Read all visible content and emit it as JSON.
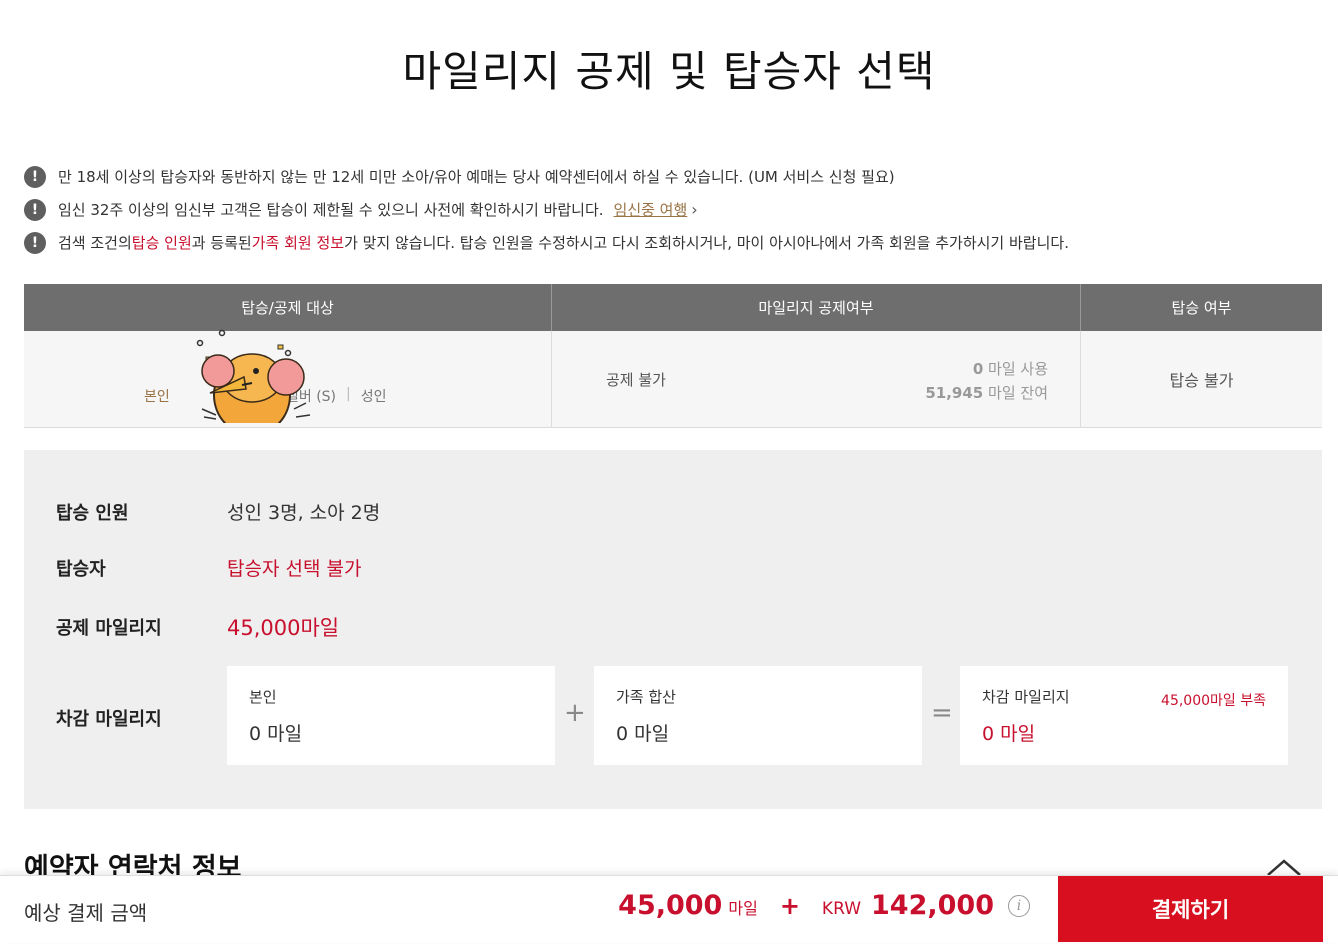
{
  "page": {
    "title": "마일리지 공제 및 탑승자 선택"
  },
  "notices": [
    {
      "parts": [
        {
          "text": "만 18세 이상의 탑승자와 동반하지 않는 만 12세 미만 소아/유아 예매는 당사 예약센터에서 하실 수 있습니다. (UM 서비스 신청 필요)"
        }
      ]
    },
    {
      "text": "임신 32주 이상의 임신부 고객은 탑승이 제한될 수 있으니 사전에 확인하시기 바랍니다.",
      "link": "임신중 여행",
      "chevron": "›"
    },
    {
      "p1": "검색 조건의 ",
      "r1": "탑승 인원",
      "p2": "과 등록된 ",
      "r2": "가족 회원 정보",
      "p3": "가 맞지 않습니다. 탑승 인원을 수정하시고 다시 조회하시거나, 마이 아시아나에서 가족 회원을 추가하시기 바랍니다."
    }
  ],
  "table": {
    "headers": [
      "탑승/공제 대상",
      "마일리지 공제여부",
      "탑승 여부"
    ],
    "row": {
      "self": "본인",
      "type_partial": "D",
      "silver": "실버 (S)",
      "adult": "성인",
      "deduction": "공제 불가",
      "miles_used_num": "0",
      "miles_used_suffix": "마일 사용",
      "miles_left_num": "51,945",
      "miles_left_suffix": "마일 잔여",
      "boarding": "탑승 불가"
    }
  },
  "summary": {
    "pax_label": "탑승 인원",
    "pax_value": "성인 3명, 소아 2명",
    "passenger_label": "탑승자",
    "passenger_value": "탑승자 선택 불가",
    "deduct_label": "공제 마일리지",
    "deduct_value": "45,000마일",
    "subtract_label": "차감 마일리지",
    "box_self_label": "본인",
    "box_self_value": "0 마일",
    "box_family_label": "가족 합산",
    "box_family_value": "0 마일",
    "box_total_label": "차감 마일리지",
    "box_total_short": "45,000마일 부족",
    "box_total_value": "0 마일",
    "plus": "+",
    "equals": "="
  },
  "section": {
    "contact_title": "예약자 연락처 정보"
  },
  "footer": {
    "label": "예상 결제 금액",
    "miles_num": "45,000",
    "miles_unit": "마일",
    "plus": "+",
    "currency": "KRW",
    "krw_num": "142,000",
    "info_icon": "i",
    "pay_button": "결제하기"
  },
  "colors": {
    "accent_red": "#d70f1e",
    "header_gray": "#6e6e6e",
    "link_brown": "#9a7447"
  }
}
